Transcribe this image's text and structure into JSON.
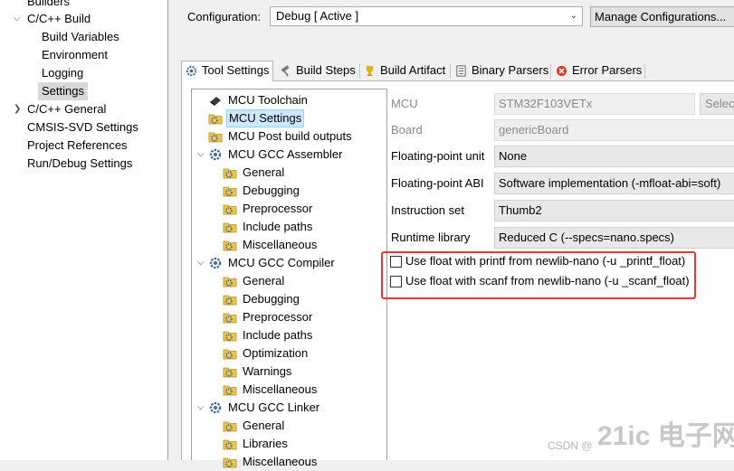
{
  "left_nav": {
    "items": [
      {
        "label": "Builders",
        "indent": 1,
        "twisty": ""
      },
      {
        "label": "C/C++ Build",
        "indent": 1,
        "twisty": "v"
      },
      {
        "label": "Build Variables",
        "indent": 2,
        "twisty": ""
      },
      {
        "label": "Environment",
        "indent": 2,
        "twisty": ""
      },
      {
        "label": "Logging",
        "indent": 2,
        "twisty": ""
      },
      {
        "label": "Settings",
        "indent": 2,
        "twisty": "",
        "selected": true
      },
      {
        "label": "C/C++ General",
        "indent": 1,
        "twisty": ">"
      },
      {
        "label": "CMSIS-SVD Settings",
        "indent": 1,
        "twisty": ""
      },
      {
        "label": "Project References",
        "indent": 1,
        "twisty": ""
      },
      {
        "label": "Run/Debug Settings",
        "indent": 1,
        "twisty": ""
      }
    ]
  },
  "configuration": {
    "label": "Configuration:",
    "value": "Debug  [ Active ]",
    "manage_button": "Manage Configurations..."
  },
  "tabs": [
    {
      "label": "Tool Settings",
      "active": true,
      "icon": "gear-icon"
    },
    {
      "label": "Build Steps",
      "active": false,
      "icon": "hammer-icon"
    },
    {
      "label": "Build Artifact",
      "active": false,
      "icon": "trophy-icon"
    },
    {
      "label": "Binary Parsers",
      "active": false,
      "icon": "binary-icon"
    },
    {
      "label": "Error Parsers",
      "active": false,
      "icon": "error-icon"
    }
  ],
  "tool_tree": [
    {
      "label": "MCU Toolchain",
      "level": 0,
      "twisty": "",
      "icon": "chip-icon"
    },
    {
      "label": "MCU Settings",
      "level": 0,
      "twisty": "",
      "icon": "folder-gear-icon",
      "selected": true
    },
    {
      "label": "MCU Post build outputs",
      "level": 0,
      "twisty": "",
      "icon": "folder-gear-icon"
    },
    {
      "label": "MCU GCC Assembler",
      "level": 0,
      "twisty": "v",
      "icon": "gear-icon"
    },
    {
      "label": "General",
      "level": 1,
      "twisty": "",
      "icon": "folder-gear-icon"
    },
    {
      "label": "Debugging",
      "level": 1,
      "twisty": "",
      "icon": "folder-gear-icon"
    },
    {
      "label": "Preprocessor",
      "level": 1,
      "twisty": "",
      "icon": "folder-gear-icon"
    },
    {
      "label": "Include paths",
      "level": 1,
      "twisty": "",
      "icon": "folder-gear-icon"
    },
    {
      "label": "Miscellaneous",
      "level": 1,
      "twisty": "",
      "icon": "folder-gear-icon"
    },
    {
      "label": "MCU GCC Compiler",
      "level": 0,
      "twisty": "v",
      "icon": "gear-icon"
    },
    {
      "label": "General",
      "level": 1,
      "twisty": "",
      "icon": "folder-gear-icon"
    },
    {
      "label": "Debugging",
      "level": 1,
      "twisty": "",
      "icon": "folder-gear-icon"
    },
    {
      "label": "Preprocessor",
      "level": 1,
      "twisty": "",
      "icon": "folder-gear-icon"
    },
    {
      "label": "Include paths",
      "level": 1,
      "twisty": "",
      "icon": "folder-gear-icon"
    },
    {
      "label": "Optimization",
      "level": 1,
      "twisty": "",
      "icon": "folder-gear-icon"
    },
    {
      "label": "Warnings",
      "level": 1,
      "twisty": "",
      "icon": "folder-gear-icon"
    },
    {
      "label": "Miscellaneous",
      "level": 1,
      "twisty": "",
      "icon": "folder-gear-icon"
    },
    {
      "label": "MCU GCC Linker",
      "level": 0,
      "twisty": "v",
      "icon": "gear-icon"
    },
    {
      "label": "General",
      "level": 1,
      "twisty": "",
      "icon": "folder-gear-icon"
    },
    {
      "label": "Libraries",
      "level": 1,
      "twisty": "",
      "icon": "folder-gear-icon"
    },
    {
      "label": "Miscellaneous",
      "level": 1,
      "twisty": "",
      "icon": "folder-gear-icon"
    }
  ],
  "properties": {
    "mcu": {
      "label": "MCU",
      "value": "STM32F103VETx",
      "button": "Select..."
    },
    "board": {
      "label": "Board",
      "value": "genericBoard"
    },
    "fpu": {
      "label": "Floating-point unit",
      "value": "None"
    },
    "fabi": {
      "label": "Floating-point ABI",
      "value": "Software implementation (-mfloat-abi=soft)"
    },
    "iset": {
      "label": "Instruction set",
      "value": "Thumb2"
    },
    "runtime": {
      "label": "Runtime library",
      "value": "Reduced C (--specs=nano.specs)"
    }
  },
  "checkboxes": [
    {
      "label": "Use float with printf from newlib-nano (-u _printf_float)",
      "checked": false
    },
    {
      "label": "Use float with scanf from newlib-nano (-u _scanf_float)",
      "checked": false
    }
  ],
  "watermark": {
    "csdn": "CSDN @",
    "logo": "21ic 电子网"
  },
  "colors": {
    "highlight": "#e53935",
    "selection": "#cce8ff"
  }
}
